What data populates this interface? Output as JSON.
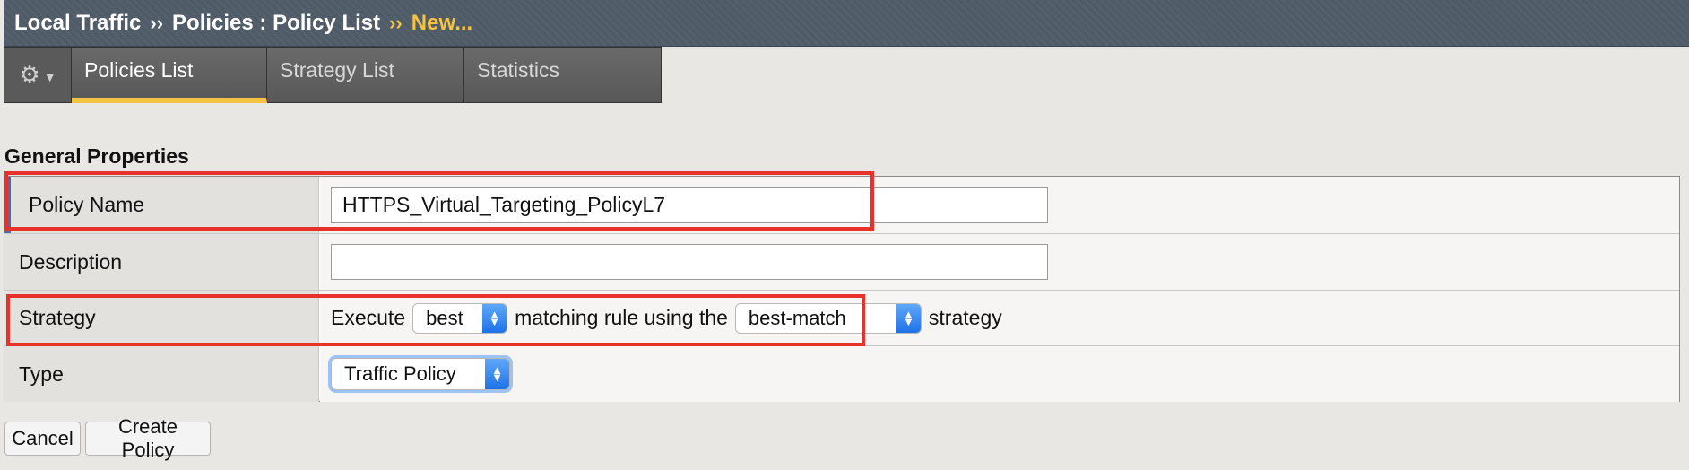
{
  "breadcrumb": {
    "items": [
      "Local Traffic",
      "Policies : Policy List"
    ],
    "separator": "››",
    "current": "New..."
  },
  "tabs": {
    "gear_icon": "gear-icon",
    "items": [
      {
        "label": "Policies List",
        "active": true
      },
      {
        "label": "Strategy List",
        "active": false
      },
      {
        "label": "Statistics",
        "active": false
      }
    ]
  },
  "section": {
    "title": "General Properties"
  },
  "form": {
    "policy_name": {
      "label": "Policy Name",
      "value": "HTTPS_Virtual_Targeting_PolicyL7"
    },
    "description": {
      "label": "Description",
      "value": ""
    },
    "strategy": {
      "label": "Strategy",
      "text_before": "Execute",
      "match_select": "best",
      "text_middle": "matching rule using the",
      "strategy_select": "best-match",
      "text_after": "strategy"
    },
    "type": {
      "label": "Type",
      "value": "Traffic Policy"
    }
  },
  "buttons": {
    "cancel": "Cancel",
    "create": "Create Policy"
  },
  "colors": {
    "accent": "#f5c242",
    "highlight": "#e8312b",
    "header": "#4f5b67"
  }
}
